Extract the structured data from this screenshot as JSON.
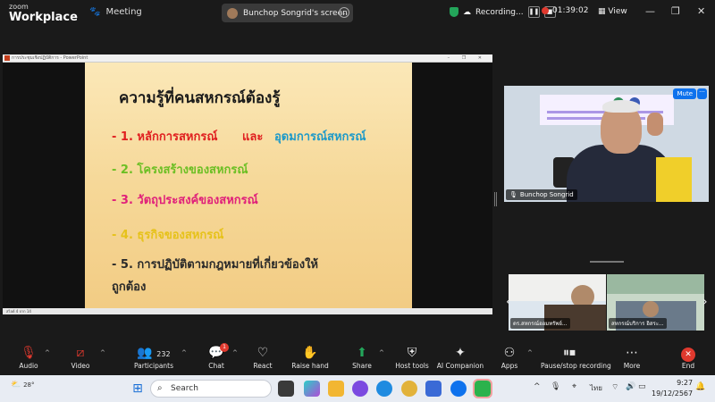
{
  "titlebar": {
    "brand_top": "zoom",
    "brand_bottom": "Workplace",
    "meeting_label": "Meeting",
    "screen_label": "Bunchop Songrid's screen",
    "recording_label": "Recording...",
    "timer": "01:39:02",
    "view_label": "View"
  },
  "share": {
    "window_title": "การประชุมเชิงปฏิบัติการ - PowerPoint",
    "slide": {
      "title": "ความรู้ที่คนสหกรณ์ต้องรู้",
      "item1_a": "- 1. หลักการสหกรณ์",
      "item1_and": "และ",
      "item1_b": "อุดมการณ์สหกรณ์",
      "item2": "- 2. โครงสร้างของสหกรณ์",
      "item3": "- 3. วัตถุประสงค์ของสหกรณ์",
      "item4": "- 4. ธุรกิจของสหกรณ์",
      "item5_line1": "- 5. การปฏิบัติตามกฎหมายที่เกี่ยวข้องให้",
      "item5_line2": "ถูกต้อง"
    },
    "status_left": "สไลด์ 4 จาก 14"
  },
  "speaker": {
    "name": "Bunchop Songrid",
    "mute_label": "Mute",
    "more_label": "···"
  },
  "thumbnails": [
    {
      "name": "ดร.สหกรณ์ออมทรัพย์..."
    },
    {
      "name": "สหกรณ์บริการ อิสระ..."
    }
  ],
  "toolbar": {
    "audio": "Audio",
    "video": "Video",
    "participants": "Participants",
    "participants_count": "232",
    "chat": "Chat",
    "chat_badge": "1",
    "react": "React",
    "raise_hand": "Raise hand",
    "share": "Share",
    "host_tools": "Host tools",
    "ai_companion": "AI Companion",
    "apps": "Apps",
    "pause_rec": "Pause/stop recording",
    "more": "More",
    "end": "End"
  },
  "taskbar": {
    "weather": "28°",
    "search_placeholder": "Search",
    "lang": "ไทย",
    "time": "9:27",
    "date": "19/12/2567"
  },
  "colors": {
    "accent_blue": "#0e72ed",
    "end_red": "#e0392e",
    "rec_green": "#23a55a"
  }
}
